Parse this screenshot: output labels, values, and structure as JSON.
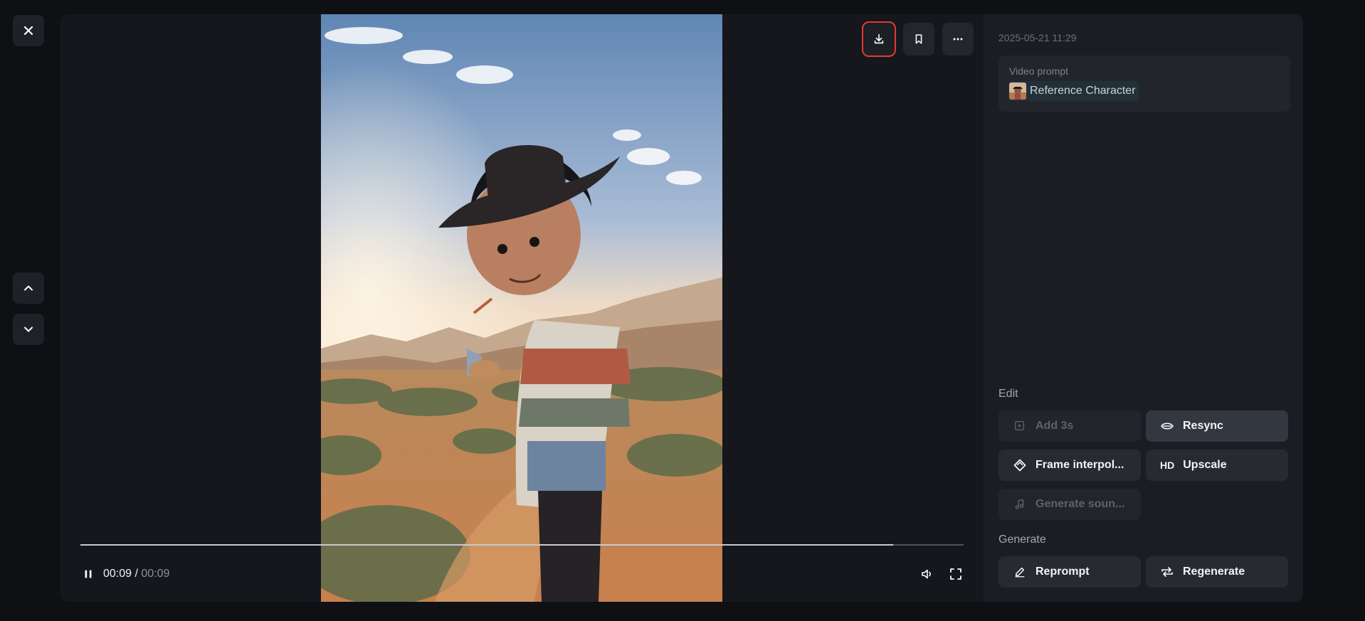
{
  "nav": {
    "close_icon": "close-icon",
    "prev_icon": "chevron-up-icon",
    "next_icon": "chevron-down-icon"
  },
  "toolbar": {
    "download_icon": "download-icon",
    "bookmark_icon": "bookmark-icon",
    "more_icon": "more-horizontal-icon"
  },
  "player": {
    "current_time": "00:09",
    "separator": "/",
    "duration": "00:09",
    "progress": 0.92,
    "state": "playing"
  },
  "panel": {
    "timestamp": "2025-05-21 11:29",
    "prompt_label": "Video prompt",
    "reference_label": "Reference Character",
    "edit_label": "Edit",
    "generate_label": "Generate",
    "actions": {
      "add3s": "Add 3s",
      "resync": "Resync",
      "frame_interp": "Frame interpol...",
      "upscale_prefix": "HD",
      "upscale": "Upscale",
      "generate_sound": "Generate soun...",
      "reprompt": "Reprompt",
      "regenerate": "Regenerate"
    }
  },
  "colors": {
    "highlight": "#e23b2e",
    "background": "#0e1014",
    "panel": "#1a1d23"
  }
}
